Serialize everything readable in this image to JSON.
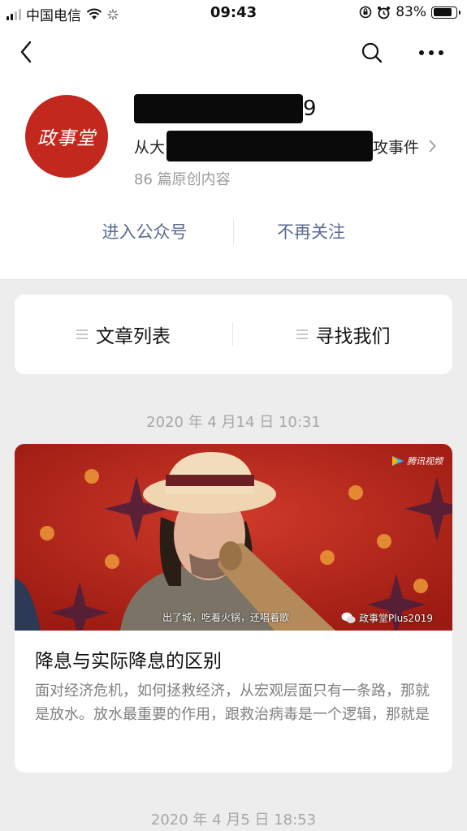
{
  "status_bar": {
    "carrier": "中国电信",
    "time": "09:43",
    "battery": "83%",
    "battery_level": 0.83
  },
  "profile": {
    "avatar_text": "政事堂",
    "name_visible_suffix": "9",
    "description_prefix": "从大",
    "description_suffix": "攻事件",
    "article_count": "86 篇原创内容",
    "brand_color": "#c2281e"
  },
  "actions": {
    "enter": "进入公众号",
    "unfollow": "不再关注",
    "link_color": "#576b95"
  },
  "menu": {
    "items": [
      {
        "label": "文章列表",
        "icon": "list-icon"
      },
      {
        "label": "寻找我们",
        "icon": "list-icon"
      }
    ]
  },
  "feed": {
    "date_1": "2020 年 4 月14 日 10:31",
    "article": {
      "title": "降息与实际降息的区别",
      "summary": "面对经济危机，如何拯救经济，从宏观层面只有一条路，那就是放水。放水最重要的作用，跟救治病毒是一个逻辑，那就是",
      "cover_caption": "出了城，吃着火锅，还唱着歌",
      "cover_watermark": "政事堂Plus2019",
      "cover_logo": "腾讯视频"
    },
    "date_2": "2020 年 4 月5 日 18:53"
  }
}
